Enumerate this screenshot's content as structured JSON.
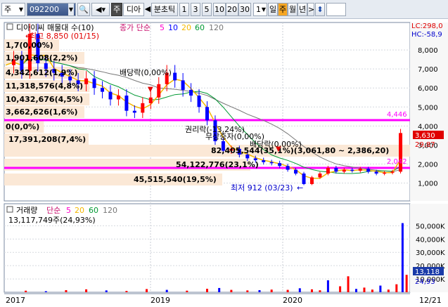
{
  "toolbar": {
    "market": "주",
    "code": "092200",
    "name": "디아이",
    "range_options": [
      "1",
      "3",
      "5",
      "10",
      "20",
      "30"
    ],
    "count": "1",
    "period_tabs": [
      "일",
      "주",
      "월",
      "년"
    ],
    "active_period": "주",
    "colors": {
      "active_tab": "#f6a623",
      "selected_field": "#3a5488"
    }
  },
  "chart": {
    "price": {
      "title": "디아이씨 매물대 수(10)",
      "high_note": "최고 8,850 (01/15)",
      "low_note": "최저 912 (03/23)",
      "ma_label": "종가 단순",
      "ma_periods": [
        "5",
        "10",
        "20",
        "60",
        "120"
      ],
      "ma_colors": [
        "#ff00cc",
        "#0000ff",
        "#f5b800",
        "#009933",
        "#777777"
      ],
      "lc_label": "LC:298,0",
      "hc_label": "HC:-58,9",
      "y_ticks": [
        "8,000",
        "7,000",
        "6,000",
        "5,000",
        "4,000",
        "3,000",
        "2,000",
        "1,000"
      ],
      "hline_upper": "4,446",
      "hline_lower": "2,042",
      "price_tag": "3,630",
      "pct_tag": "29,87",
      "volume_profile": [
        "1,7(0,00%)",
        "1,901,608(2,2%)",
        "4,342,612(1,9%)",
        "11,318,576(4,8%)",
        "10,432,676(4,5%)",
        "3,662,626(1,6%)",
        "0(0,0%)",
        "17,391,208(7,4%)",
        "82,405,544(35,1%)(3,061,80 ~ 2,386,20)",
        "54,122,776(23,1%)",
        "45,515,540(19,5%)"
      ],
      "events": [
        "배당락(0,00%)",
        "권리락(-13,24%)",
        "무상증자(0,00%)",
        "배당락(0,00%)"
      ]
    },
    "volume": {
      "title": "거래량",
      "ma_label": "단순",
      "ma_periods": [
        "5",
        "20",
        "60",
        "120"
      ],
      "ma_colors": [
        "#ff00cc",
        "#f5b800",
        "#009933",
        "#777777"
      ],
      "current": "13,117,749주(24,93%)",
      "y_ticks": [
        "50,000K",
        "40,000K",
        "30,000K",
        "20,000K",
        "10,000K"
      ],
      "last_tag": "13,118",
      "last_pct": "24,93"
    },
    "x_labels": [
      "2017",
      "2019",
      "2020",
      "12/21"
    ],
    "colors": {
      "up": "#ff0000",
      "down": "#0000ff",
      "hline": "#ff00ff",
      "profile": "#fbe8d6"
    }
  },
  "price_series": [
    [
      0.0,
      7200
    ],
    [
      0.02,
      7500
    ],
    [
      0.04,
      6900
    ],
    [
      0.06,
      8850
    ],
    [
      0.08,
      7300
    ],
    [
      0.1,
      7000
    ],
    [
      0.12,
      6800
    ],
    [
      0.14,
      6600
    ],
    [
      0.16,
      6400
    ],
    [
      0.18,
      6200
    ],
    [
      0.2,
      6500
    ],
    [
      0.22,
      6000
    ],
    [
      0.24,
      5800
    ],
    [
      0.26,
      5400
    ],
    [
      0.28,
      5600
    ],
    [
      0.3,
      4800
    ],
    [
      0.32,
      4700
    ],
    [
      0.34,
      5200
    ],
    [
      0.36,
      5500
    ],
    [
      0.38,
      6200
    ],
    [
      0.4,
      6800
    ],
    [
      0.42,
      6400
    ],
    [
      0.44,
      5900
    ],
    [
      0.46,
      5600
    ],
    [
      0.48,
      5000
    ],
    [
      0.5,
      4300
    ],
    [
      0.52,
      3200
    ],
    [
      0.54,
      2700
    ],
    [
      0.56,
      2800
    ],
    [
      0.58,
      2500
    ],
    [
      0.6,
      2300
    ],
    [
      0.62,
      2200
    ],
    [
      0.64,
      2100
    ],
    [
      0.66,
      2050
    ],
    [
      0.68,
      1900
    ],
    [
      0.7,
      1700
    ],
    [
      0.72,
      1500
    ],
    [
      0.74,
      950
    ],
    [
      0.76,
      1300
    ],
    [
      0.78,
      1500
    ],
    [
      0.8,
      1800
    ],
    [
      0.82,
      1600
    ],
    [
      0.84,
      1700
    ],
    [
      0.86,
      1650
    ],
    [
      0.88,
      1750
    ],
    [
      0.9,
      1600
    ],
    [
      0.92,
      1500
    ],
    [
      0.94,
      1550
    ],
    [
      0.96,
      1600
    ],
    [
      0.98,
      3630
    ]
  ],
  "volume_series": [
    [
      0.05,
      1.2
    ],
    [
      0.1,
      0.8
    ],
    [
      0.15,
      1.6
    ],
    [
      0.2,
      2.2
    ],
    [
      0.25,
      1.4
    ],
    [
      0.3,
      1.0
    ],
    [
      0.35,
      2.4
    ],
    [
      0.4,
      1.8
    ],
    [
      0.45,
      1.2
    ],
    [
      0.5,
      2.6
    ],
    [
      0.53,
      3.2
    ],
    [
      0.56,
      1.8
    ],
    [
      0.6,
      1.4
    ],
    [
      0.63,
      1.6
    ],
    [
      0.66,
      2.0
    ],
    [
      0.7,
      1.8
    ],
    [
      0.73,
      3.0
    ],
    [
      0.76,
      2.2
    ],
    [
      0.78,
      1.5
    ],
    [
      0.8,
      9.0
    ],
    [
      0.83,
      4.5
    ],
    [
      0.85,
      12.0
    ],
    [
      0.87,
      2.5
    ],
    [
      0.89,
      3.5
    ],
    [
      0.91,
      2.0
    ],
    [
      0.93,
      5.0
    ],
    [
      0.95,
      2.0
    ],
    [
      0.97,
      6.0
    ],
    [
      0.985,
      52.0
    ],
    [
      0.995,
      13.1
    ]
  ]
}
